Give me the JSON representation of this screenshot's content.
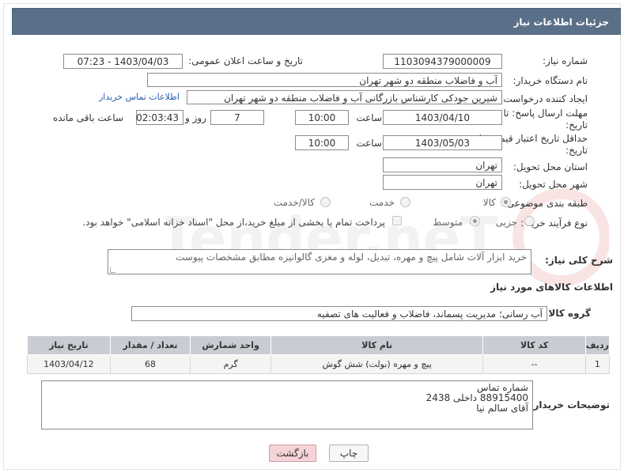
{
  "header": {
    "title": "جزئیات اطلاعات نیاز"
  },
  "form": {
    "need_number_label": "شماره نیاز:",
    "need_number": "1103094379000009",
    "announce_label": "تاریخ و ساعت اعلان عمومی:",
    "announce_value": "1403/04/03 - 07:23",
    "buyer_org_label": "نام دستگاه خریدار:",
    "buyer_org": "آب و فاضلاب منطقه دو شهر تهران",
    "requester_label": "ایجاد کننده درخواست:",
    "requester": "شیرین جودکی کارشناس بازرگانی  آب و فاضلاب منطقه دو شهر تهران",
    "contact_link": "اطلاعات تماس خریدار",
    "reply_deadline_label_1": "مهلت ارسال پاسخ: تا",
    "reply_deadline_label_2": "تاریخ:",
    "reply_date": "1403/04/10",
    "time_label": "ساعت",
    "reply_time": "10:00",
    "days": "7",
    "days_label": "روز و",
    "remaining_time": "02:03:43",
    "remaining_label": "ساعت باقی مانده",
    "price_validity_label_1": "حداقل تاریخ اعتبار قیمت: تا",
    "price_validity_label_2": "تاریخ:",
    "price_date": "1403/05/03",
    "price_time": "10:00",
    "province_label": "استان محل تحویل:",
    "province": "تهران",
    "city_label": "شهر محل تحویل:",
    "city": "تهران",
    "category_label": "طبقه بندی موضوعی:",
    "category_options": [
      "کالا",
      "خدمت",
      "کالا/خدمت"
    ],
    "process_label": "نوع فرآیند خرید :",
    "process_options": [
      "جزیی",
      "متوسط"
    ],
    "payment_note": "پرداخت تمام یا بخشی از مبلغ خرید،از محل \"اسناد خزانه اسلامی\" خواهد بود.",
    "description_label": "شرح کلی نیاز:",
    "description": "خرید ابزار آلات شامل پیچ و مهره، تبدیل، لوله و مغزی گالوانیزه مطابق مشخصات پیوست",
    "goods_info_title": "اطلاعات کالاهای مورد نیاز",
    "goods_group_label": "گروه کالا:",
    "goods_group": "آب رسانی؛ مدیریت پسماند، فاضلاب و فعالیت های تصفیه",
    "buyer_notes_label": "توضیحات خریدار:",
    "buyer_notes_line1": "شماره تماس",
    "buyer_notes_line2": "88915400 داخلی 2438",
    "buyer_notes_line3": "آقای سالم نیا"
  },
  "table": {
    "headers": [
      "ردیف",
      "کد کالا",
      "نام کالا",
      "واحد شمارش",
      "تعداد / مقدار",
      "تاریخ نیاز"
    ],
    "rows": [
      [
        "1",
        "--",
        "پیچ و مهره (بولت) شش گوش",
        "گرم",
        "68",
        "1403/04/12"
      ]
    ]
  },
  "buttons": {
    "print": "چاپ",
    "back": "بازگشت"
  },
  "watermark": "AriaTender.neT",
  "colors": {
    "header_bg": "#5a7088",
    "back_btn_bg": "#f6d3d6",
    "link": "#2a5db0"
  }
}
